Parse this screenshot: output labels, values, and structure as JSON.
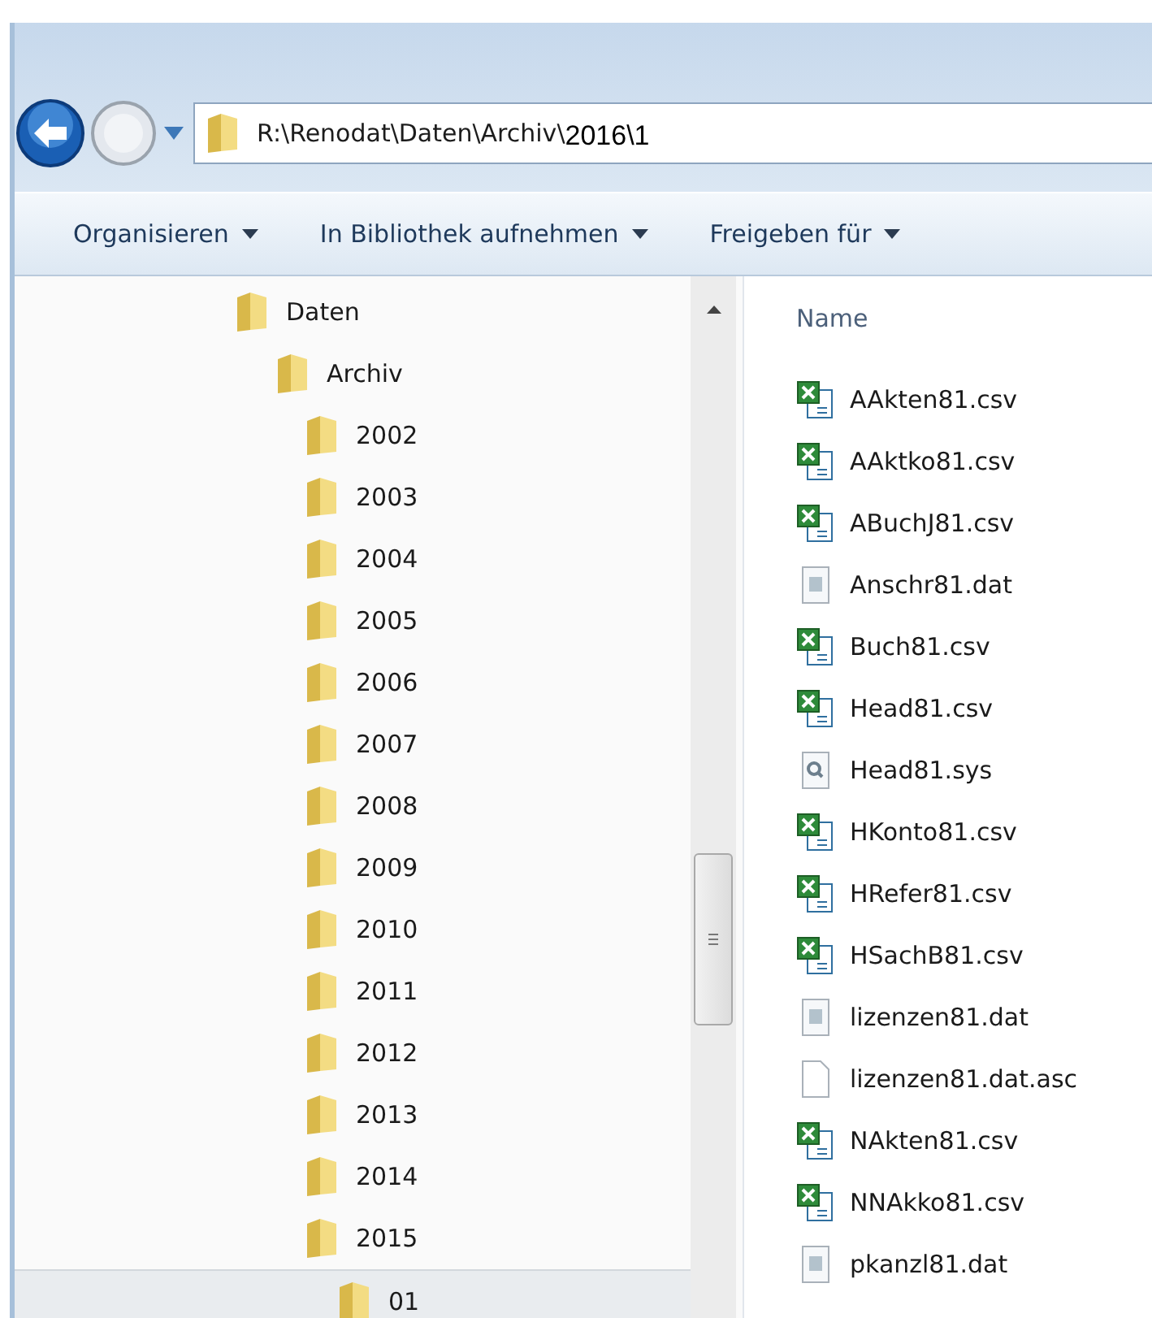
{
  "address_bar": {
    "segments": [
      {
        "text": "R:\\Renodat\\Daten\\Archiv\\",
        "kind": "path"
      },
      {
        "text": "2016\\1",
        "kind": "typed"
      }
    ]
  },
  "toolbar": [
    {
      "label": "Organisieren"
    },
    {
      "label": "In Bibliothek aufnehmen"
    },
    {
      "label": "Freigeben für"
    }
  ],
  "tree": [
    {
      "label": "Daten",
      "selected": false,
      "children": [
        {
          "label": "Archiv",
          "selected": false,
          "children": [
            {
              "label": "2002",
              "selected": false
            },
            {
              "label": "2003",
              "selected": false
            },
            {
              "label": "2004",
              "selected": false
            },
            {
              "label": "2005",
              "selected": false
            },
            {
              "label": "2006",
              "selected": false
            },
            {
              "label": "2007",
              "selected": false
            },
            {
              "label": "2008",
              "selected": false
            },
            {
              "label": "2009",
              "selected": false
            },
            {
              "label": "2010",
              "selected": false
            },
            {
              "label": "2011",
              "selected": false
            },
            {
              "label": "2012",
              "selected": false
            },
            {
              "label": "2013",
              "selected": false
            },
            {
              "label": "2014",
              "selected": false
            },
            {
              "label": "2015",
              "selected": false,
              "children": [
                {
                  "label": "01",
                  "selected": true
                }
              ]
            }
          ]
        }
      ]
    }
  ],
  "files": {
    "column_header": "Name",
    "items": [
      {
        "name": "AAkten81.csv",
        "kind": "spreadsheet"
      },
      {
        "name": "AAktko81.csv",
        "kind": "spreadsheet"
      },
      {
        "name": "ABuchJ81.csv",
        "kind": "spreadsheet"
      },
      {
        "name": "Anschr81.dat",
        "kind": "data"
      },
      {
        "name": "Buch81.csv",
        "kind": "spreadsheet"
      },
      {
        "name": "Head81.csv",
        "kind": "spreadsheet"
      },
      {
        "name": "Head81.sys",
        "kind": "system"
      },
      {
        "name": "HKonto81.csv",
        "kind": "spreadsheet"
      },
      {
        "name": "HRefer81.csv",
        "kind": "spreadsheet"
      },
      {
        "name": "HSachB81.csv",
        "kind": "spreadsheet"
      },
      {
        "name": "lizenzen81.dat",
        "kind": "data"
      },
      {
        "name": "lizenzen81.dat.asc",
        "kind": "blank"
      },
      {
        "name": "NAkten81.csv",
        "kind": "spreadsheet"
      },
      {
        "name": "NNAkko81.csv",
        "kind": "spreadsheet"
      },
      {
        "name": "pkanzl81.dat",
        "kind": "data"
      }
    ]
  }
}
